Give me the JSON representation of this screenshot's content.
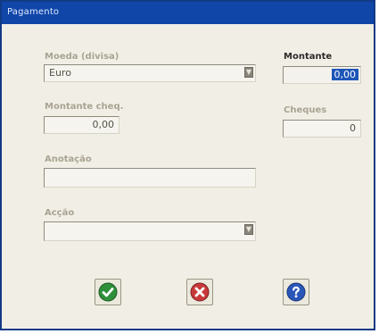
{
  "window": {
    "title": "Pagamento"
  },
  "form": {
    "currency": {
      "label": "Moeda (divisa)",
      "value": "Euro",
      "dropdown_icon": "dropdown-icon"
    },
    "amount": {
      "label": "Montante",
      "value": "0,00"
    },
    "check_amount": {
      "label": "Montante cheq.",
      "value": "0,00"
    },
    "checks": {
      "label": "Cheques",
      "value": "0"
    },
    "annotation": {
      "label": "Anotação",
      "value": ""
    },
    "action": {
      "label": "Acção",
      "value": "",
      "dropdown_icon": "dropdown-icon"
    }
  },
  "buttons": {
    "ok": {
      "icon": "check-icon",
      "color": "#2f8f3a"
    },
    "cancel": {
      "icon": "close-icon",
      "color": "#c73a3a"
    },
    "help": {
      "icon": "help-icon",
      "color": "#2a56b8"
    }
  },
  "colors": {
    "titlebar": "#0f46a8",
    "accent_selection": "#1e56b8"
  }
}
